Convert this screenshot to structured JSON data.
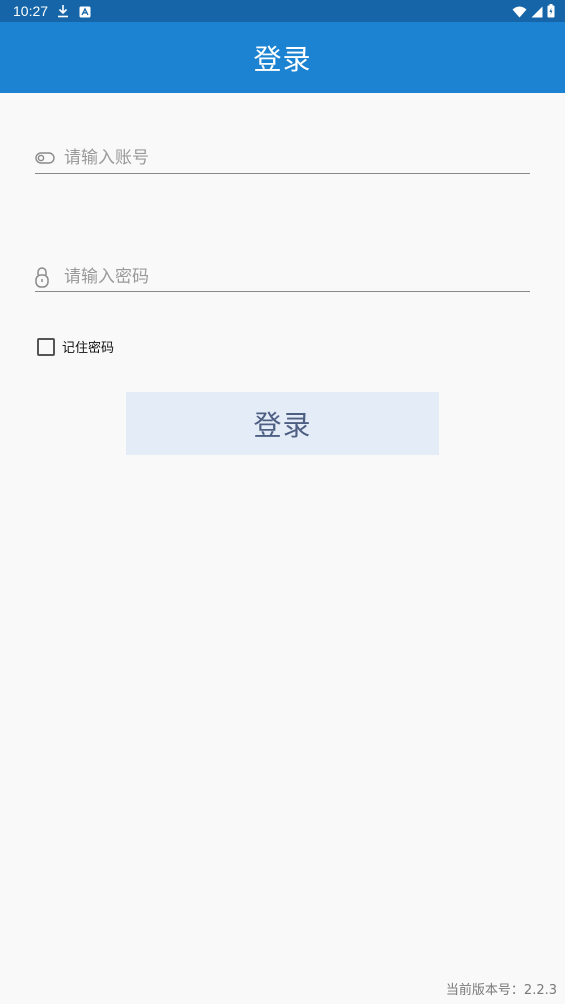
{
  "status_bar": {
    "time": "10:27",
    "background": "#1565a8"
  },
  "app_bar": {
    "title": "登录",
    "background": "#1c83d2"
  },
  "form": {
    "account_placeholder": "请输入账号",
    "account_value": "",
    "password_placeholder": "请输入密码",
    "password_value": "",
    "remember_label": "记住密码",
    "remember_checked": false,
    "login_label": "登录"
  },
  "footer": {
    "version_text": "当前版本号：2.2.3"
  },
  "icons": {
    "account": "toggle-icon",
    "password": "lock-icon"
  },
  "colors": {
    "button_bg": "#e4ecf7",
    "button_text": "#4e5f84"
  }
}
